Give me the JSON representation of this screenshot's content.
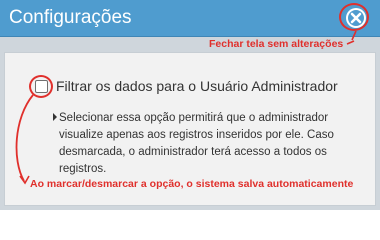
{
  "window": {
    "title": "Configurações"
  },
  "icons": {
    "close": "close-icon"
  },
  "annotations": {
    "close_note": "Fechar tela sem alterações",
    "autosave_note": "Ao marcar/desmarcar a opção, o sistema salva automaticamente"
  },
  "setting": {
    "checkbox_label": "Filtrar os dados para o Usuário Administrador",
    "checked": false,
    "description": "Selecionar essa opção permitirá que o administrador visualize apenas aos registros inseridos por ele. Caso desmarcada, o administrador terá acesso a todos os registros."
  },
  "colors": {
    "titlebar": "#4f9ccf",
    "annotation": "#e0302c",
    "background": "#cfd6dc",
    "panel": "#f2f2f2"
  }
}
